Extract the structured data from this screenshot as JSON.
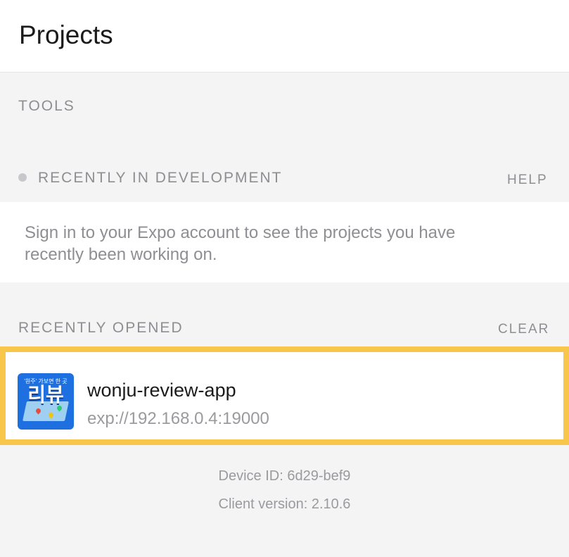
{
  "header": {
    "title": "Projects"
  },
  "tools": {
    "label": "TOOLS"
  },
  "recent_dev": {
    "label": "RECENTLY IN DEVELOPMENT",
    "help_label": "HELP",
    "message": "Sign in to your Expo account to see the projects you have recently been working on."
  },
  "recent_opened": {
    "label": "RECENTLY OPENED",
    "clear_label": "CLEAR",
    "projects": [
      {
        "icon_top_text": "'원주' 가보면 한 곳",
        "icon_big_text": "리뷰",
        "name": "wonju-review-app",
        "url": "exp://192.168.0.4:19000"
      }
    ]
  },
  "footer": {
    "device_id": "Device ID: 6d29-bef9",
    "client_version": "Client version: 2.10.6"
  },
  "colors": {
    "highlight_border": "#f7c64a",
    "icon_bg": "#1e6fe0"
  }
}
